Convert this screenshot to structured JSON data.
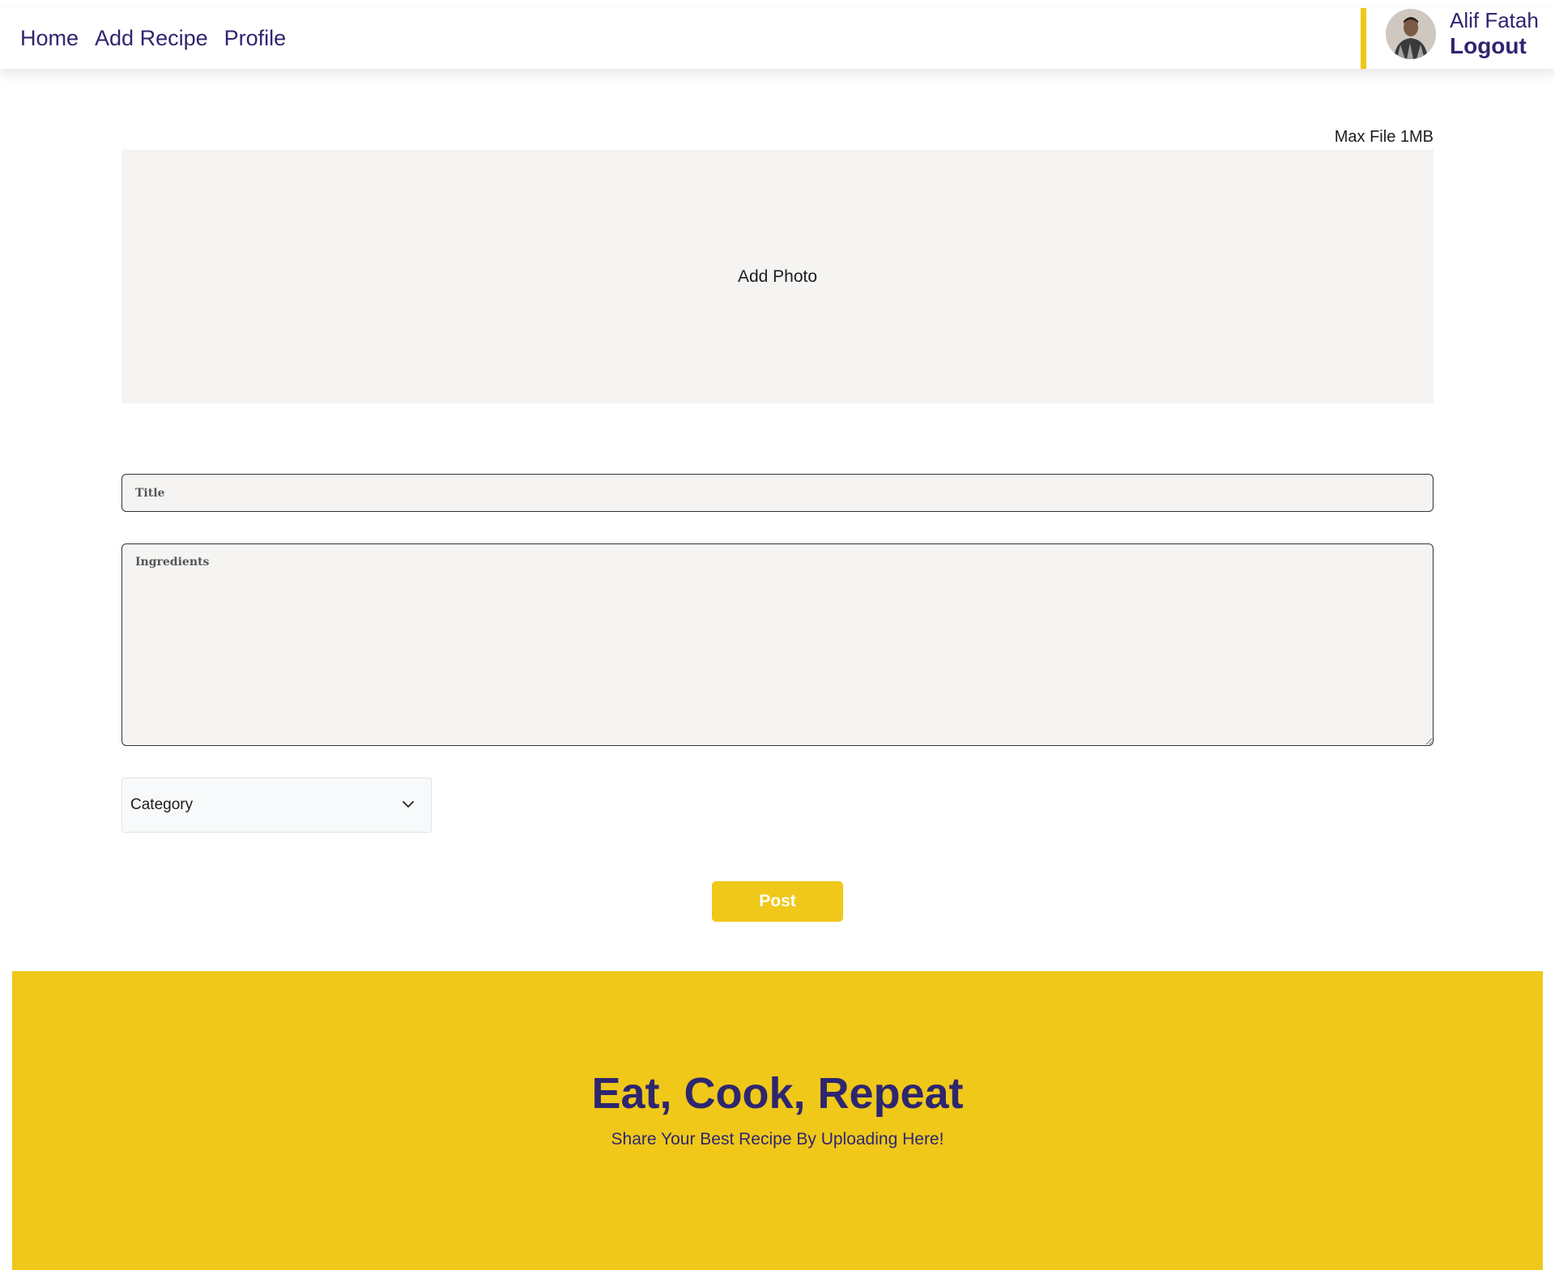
{
  "nav": {
    "links": [
      "Home",
      "Add Recipe",
      "Profile"
    ]
  },
  "user": {
    "name": "Alif Fatah",
    "logout_label": "Logout"
  },
  "upload": {
    "max_file_label": "Max File 1MB",
    "add_photo_label": "Add Photo"
  },
  "form": {
    "title_placeholder": "Title",
    "ingredients_placeholder": "Ingredients",
    "category_label": "Category",
    "post_label": "Post"
  },
  "footer": {
    "title": "Eat, Cook, Repeat",
    "subtitle": "Share Your Best Recipe By Uploading Here!"
  },
  "colors": {
    "accent": "#efc81a",
    "primary_text": "#2e266f",
    "field_background": "#f5f4f2"
  }
}
